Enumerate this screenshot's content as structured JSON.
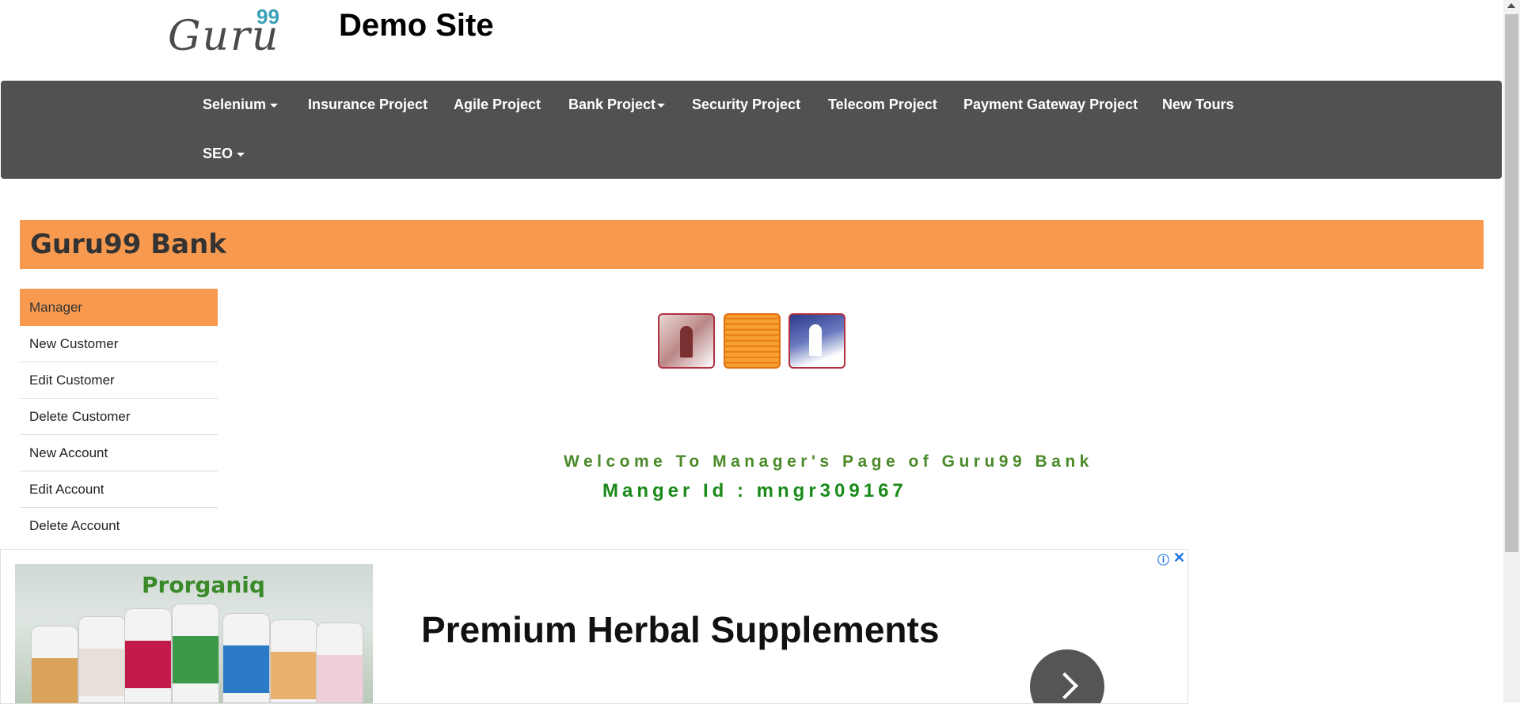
{
  "header": {
    "logo_text": "Guru",
    "logo_sup": "99",
    "site_title": "Demo Site"
  },
  "navbar": {
    "items": [
      {
        "label": "Selenium",
        "dropdown": true
      },
      {
        "label": "Insurance Project",
        "dropdown": false
      },
      {
        "label": "Agile Project",
        "dropdown": false
      },
      {
        "label": "Bank Project",
        "dropdown": true
      },
      {
        "label": "Security Project",
        "dropdown": false
      },
      {
        "label": "Telecom Project",
        "dropdown": false
      },
      {
        "label": "Payment Gateway Project",
        "dropdown": false
      },
      {
        "label": "New Tours",
        "dropdown": false
      },
      {
        "label": "SEO",
        "dropdown": true
      }
    ]
  },
  "bank": {
    "title": "Guru99 Bank"
  },
  "sidebar": {
    "header": "Manager",
    "items": [
      {
        "label": "New Customer"
      },
      {
        "label": "Edit Customer"
      },
      {
        "label": "Delete Customer"
      },
      {
        "label": "New Account"
      },
      {
        "label": "Edit Account"
      },
      {
        "label": "Delete Account"
      }
    ]
  },
  "main": {
    "welcome": "Welcome To Manager's Page of Guru99 Bank",
    "manager_id": "Manger Id : mngr309167"
  },
  "ad": {
    "brand": "Prorganiq",
    "headline": "Premium Herbal Supplements",
    "info_icon": "info-icon",
    "close_icon": "close-icon",
    "next_icon": "chevron-right-icon"
  },
  "colors": {
    "navbar_bg": "#515151",
    "accent_orange": "#f79a4f",
    "welcome_green": "#4a8a2a",
    "manager_green": "#1a8a1a"
  }
}
